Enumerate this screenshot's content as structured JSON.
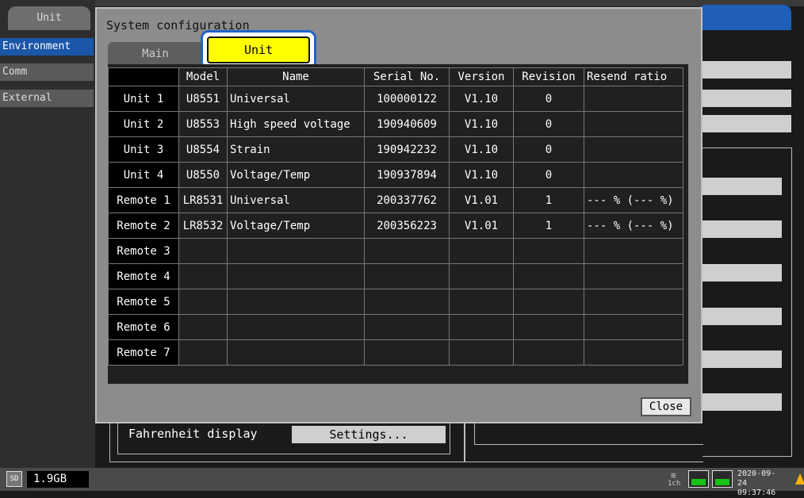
{
  "sidebar": {
    "top_tab": "Unit",
    "items": [
      {
        "label": "Environment",
        "active": true
      },
      {
        "label": "Comm",
        "active": false
      },
      {
        "label": "External",
        "active": false
      }
    ]
  },
  "dialog": {
    "title": "System configuration",
    "tabs": [
      {
        "label": "Main",
        "active": false
      },
      {
        "label": "Unit",
        "active": true
      }
    ],
    "columns": [
      "Model",
      "Name",
      "Serial No.",
      "Version",
      "Revision",
      "Resend ratio"
    ],
    "rows": [
      {
        "label": "Unit 1",
        "model": "U8551",
        "name": "Universal",
        "serial": "100000122",
        "version": "V1.10",
        "revision": "0",
        "resend": ""
      },
      {
        "label": "Unit 2",
        "model": "U8553",
        "name": "High speed voltage",
        "serial": "190940609",
        "version": "V1.10",
        "revision": "0",
        "resend": ""
      },
      {
        "label": "Unit 3",
        "model": "U8554",
        "name": "Strain",
        "serial": "190942232",
        "version": "V1.10",
        "revision": "0",
        "resend": ""
      },
      {
        "label": "Unit 4",
        "model": "U8550",
        "name": "Voltage/Temp",
        "serial": "190937894",
        "version": "V1.10",
        "revision": "0",
        "resend": ""
      },
      {
        "label": "Remote 1",
        "model": "LR8531",
        "name": "Universal",
        "serial": "200337762",
        "version": "V1.01",
        "revision": "1",
        "resend": "--- % (--- %)"
      },
      {
        "label": "Remote 2",
        "model": "LR8532",
        "name": "Voltage/Temp",
        "serial": "200356223",
        "version": "V1.01",
        "revision": "1",
        "resend": "--- % (--- %)"
      },
      {
        "label": "Remote 3",
        "model": "",
        "name": "",
        "serial": "",
        "version": "",
        "revision": "",
        "resend": ""
      },
      {
        "label": "Remote 4",
        "model": "",
        "name": "",
        "serial": "",
        "version": "",
        "revision": "",
        "resend": ""
      },
      {
        "label": "Remote 5",
        "model": "",
        "name": "",
        "serial": "",
        "version": "",
        "revision": "",
        "resend": ""
      },
      {
        "label": "Remote 6",
        "model": "",
        "name": "",
        "serial": "",
        "version": "",
        "revision": "",
        "resend": ""
      },
      {
        "label": "Remote 7",
        "model": "",
        "name": "",
        "serial": "",
        "version": "",
        "revision": "",
        "resend": ""
      }
    ],
    "close_label": "Close"
  },
  "background": {
    "fahrenheit_label": "Fahrenheit display",
    "fahrenheit_button": "Settings..."
  },
  "statusbar": {
    "storage_icon": "SD",
    "storage": "1.9GB",
    "channel_label": "1ch",
    "date": "2020-09-24",
    "time": "09:37:46"
  },
  "colors": {
    "active_tab": "#ffff00",
    "focus_ring": "#1e63c9",
    "sidebar_active": "#1b57a8",
    "battery": "#19c419",
    "warning": "#ffb300"
  }
}
